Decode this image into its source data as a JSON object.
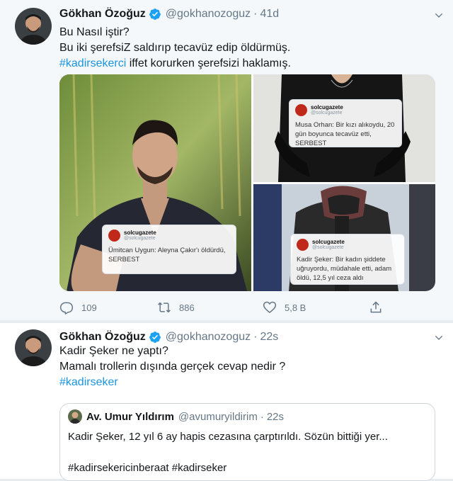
{
  "tweet1": {
    "author_name": "Gökhan Özoğuz",
    "handle": "@gokhanozoguz",
    "separator": "·",
    "time": "41d",
    "lines": [
      "Bu Nasıl iştir?",
      "Bu iki şerefsiZ saldırıp tecavüz edip öldürmüş."
    ],
    "hashtag": "#kadirsekerci",
    "hashtag_rest": " iffet korurken şerefsizi haklamış.",
    "media": [
      {
        "card_user": "solcugazete",
        "card_sub": "@solcugazete",
        "card_text": "Ümitcan Uygun: Aleyna Çakır'ı öldürdü, SERBEST"
      },
      {
        "card_user": "solcugazete",
        "card_sub": "@solcugazete",
        "card_text": "Musa Orhan: Bir kızı alıkoydu, 20 gün boyunca tecavüz etti, SERBEST"
      },
      {
        "card_user": "solcugazete",
        "card_sub": "@solcugazete",
        "card_text": "Kadir Şeker: Bir kadın şiddete uğruyordu, müdahale etti, adam öldü, 12,5 yıl ceza aldı"
      }
    ],
    "actions": {
      "reply_count": "109",
      "retweet_count": "886",
      "like_count": "5,8 B"
    }
  },
  "tweet2": {
    "author_name": "Gökhan Özoğuz",
    "handle": "@gokhanozoguz",
    "separator": "·",
    "time": "22s",
    "lines": [
      "Kadir Şeker ne yaptı?",
      "Mamalı trollerin dışında gerçek cevap nedir ?"
    ],
    "hashtag": "#kadirseker",
    "quote": {
      "author_name": "Av. Umur Yıldırım",
      "handle": "@avumuryildirim",
      "separator": "·",
      "time": "22s",
      "text": "Kadir Şeker, 12 yıl 6 ay hapis cezasına çarptırıldı. Sözün bittiği yer...",
      "hashtags": "#kadirsekericinberaat #kadirseker"
    }
  },
  "colors": {
    "link": "#1b95e0",
    "secondary_text": "#657786",
    "verified": "#1da1f2"
  },
  "icons": [
    "chevron-down-icon",
    "verified-badge-icon",
    "reply-icon",
    "retweet-icon",
    "like-icon",
    "share-icon"
  ]
}
